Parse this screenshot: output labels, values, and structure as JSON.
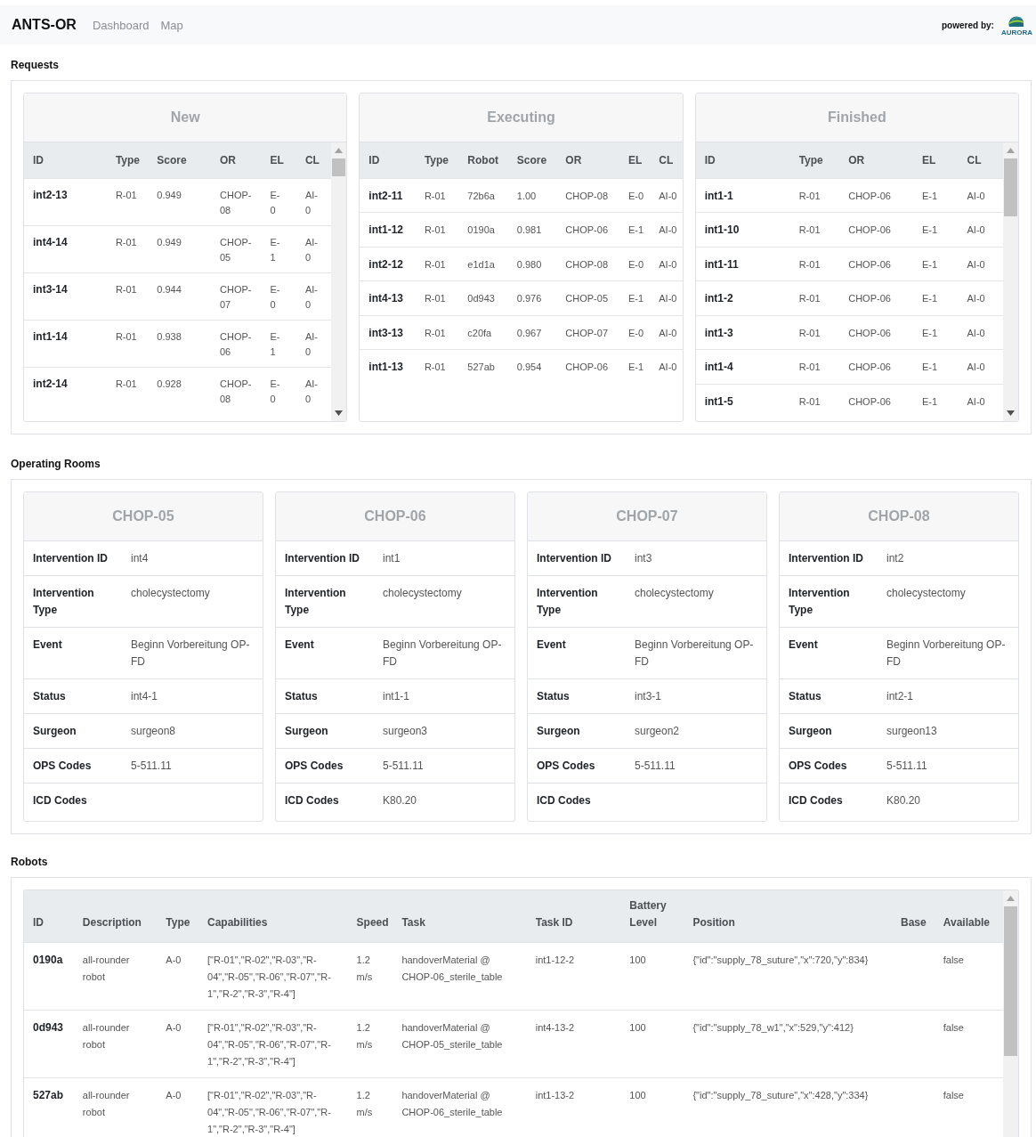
{
  "navbar": {
    "brand": "ANTS-OR",
    "links": [
      {
        "label": "Dashboard"
      },
      {
        "label": "Map"
      }
    ],
    "powered_by": "powered by:",
    "logo_text": "AURORA"
  },
  "requests": {
    "title": "Requests",
    "panels": [
      {
        "title": "New",
        "scrollable": true,
        "columns": [
          "ID",
          "Type",
          "Score",
          "OR",
          "EL",
          "CL"
        ],
        "rows": [
          [
            "int2-13",
            "R-01",
            "0.949",
            "CHOP-08",
            "E-0",
            "AI-0"
          ],
          [
            "int4-14",
            "R-01",
            "0.949",
            "CHOP-05",
            "E-1",
            "AI-0"
          ],
          [
            "int3-14",
            "R-01",
            "0.944",
            "CHOP-07",
            "E-0",
            "AI-0"
          ],
          [
            "int1-14",
            "R-01",
            "0.938",
            "CHOP-06",
            "E-1",
            "AI-0"
          ],
          [
            "int2-14",
            "R-01",
            "0.928",
            "CHOP-08",
            "E-0",
            "AI-0"
          ]
        ]
      },
      {
        "title": "Executing",
        "scrollable": false,
        "columns": [
          "ID",
          "Type",
          "Robot",
          "Score",
          "OR",
          "EL",
          "CL"
        ],
        "rows": [
          [
            "int2-11",
            "R-01",
            "72b6a",
            "1.00",
            "CHOP-08",
            "E-0",
            "AI-0"
          ],
          [
            "int1-12",
            "R-01",
            "0190a",
            "0.981",
            "CHOP-06",
            "E-1",
            "AI-0"
          ],
          [
            "int2-12",
            "R-01",
            "e1d1a",
            "0.980",
            "CHOP-08",
            "E-0",
            "AI-0"
          ],
          [
            "int4-13",
            "R-01",
            "0d943",
            "0.976",
            "CHOP-05",
            "E-1",
            "AI-0"
          ],
          [
            "int3-13",
            "R-01",
            "c20fa",
            "0.967",
            "CHOP-07",
            "E-0",
            "AI-0"
          ],
          [
            "int1-13",
            "R-01",
            "527ab",
            "0.954",
            "CHOP-06",
            "E-1",
            "AI-0"
          ]
        ]
      },
      {
        "title": "Finished",
        "scrollable": true,
        "columns": [
          "ID",
          "Type",
          "OR",
          "EL",
          "CL"
        ],
        "rows": [
          [
            "int1-1",
            "R-01",
            "CHOP-06",
            "E-1",
            "AI-0"
          ],
          [
            "int1-10",
            "R-01",
            "CHOP-06",
            "E-1",
            "AI-0"
          ],
          [
            "int1-11",
            "R-01",
            "CHOP-06",
            "E-1",
            "AI-0"
          ],
          [
            "int1-2",
            "R-01",
            "CHOP-06",
            "E-1",
            "AI-0"
          ],
          [
            "int1-3",
            "R-01",
            "CHOP-06",
            "E-1",
            "AI-0"
          ],
          [
            "int1-4",
            "R-01",
            "CHOP-06",
            "E-1",
            "AI-0"
          ],
          [
            "int1-5",
            "R-01",
            "CHOP-06",
            "E-1",
            "AI-0"
          ]
        ]
      }
    ]
  },
  "operating_rooms": {
    "title": "Operating Rooms",
    "rooms": [
      {
        "name": "CHOP-05",
        "fields": [
          {
            "label": "Intervention ID",
            "value": "int4"
          },
          {
            "label": "Intervention Type",
            "value": "cholecystectomy"
          },
          {
            "label": "Event",
            "value": "Beginn Vorbereitung OP-FD"
          },
          {
            "label": "Status",
            "value": "int4-1"
          },
          {
            "label": "Surgeon",
            "value": "surgeon8"
          },
          {
            "label": "OPS Codes",
            "value": "5-511.11"
          },
          {
            "label": "ICD Codes"
          }
        ]
      },
      {
        "name": "CHOP-06",
        "fields": [
          {
            "label": "Intervention ID",
            "value": "int1"
          },
          {
            "label": "Intervention Type",
            "value": "cholecystectomy"
          },
          {
            "label": "Event",
            "value": "Beginn Vorbereitung OP-FD"
          },
          {
            "label": "Status",
            "value": "int1-1"
          },
          {
            "label": "Surgeon",
            "value": "surgeon3"
          },
          {
            "label": "OPS Codes",
            "value": "5-511.11"
          },
          {
            "label": "ICD Codes",
            "value": "K80.20"
          }
        ]
      },
      {
        "name": "CHOP-07",
        "fields": [
          {
            "label": "Intervention ID",
            "value": "int3"
          },
          {
            "label": "Intervention Type",
            "value": "cholecystectomy"
          },
          {
            "label": "Event",
            "value": "Beginn Vorbereitung OP-FD"
          },
          {
            "label": "Status",
            "value": "int3-1"
          },
          {
            "label": "Surgeon",
            "value": "surgeon2"
          },
          {
            "label": "OPS Codes",
            "value": "5-511.11"
          },
          {
            "label": "ICD Codes"
          }
        ]
      },
      {
        "name": "CHOP-08",
        "fields": [
          {
            "label": "Intervention ID",
            "value": "int2"
          },
          {
            "label": "Intervention Type",
            "value": "cholecystectomy"
          },
          {
            "label": "Event",
            "value": "Beginn Vorbereitung OP-FD"
          },
          {
            "label": "Status",
            "value": "int2-1"
          },
          {
            "label": "Surgeon",
            "value": "surgeon13"
          },
          {
            "label": "OPS Codes",
            "value": "5-511.11"
          },
          {
            "label": "ICD Codes",
            "value": "K80.20"
          }
        ]
      }
    ]
  },
  "robots": {
    "title": "Robots",
    "columns": [
      "ID",
      "Description",
      "Type",
      "Capabilities",
      "Speed",
      "Task",
      "Task ID",
      "Battery Level",
      "Position",
      "Base",
      "Available"
    ],
    "rows": [
      [
        "0190a",
        "all-rounder robot",
        "A-0",
        "[\"R-01\",\"R-02\",\"R-03\",\"R-04\",\"R-05\",\"R-06\",\"R-07\",\"R-1\",\"R-2\",\"R-3\",\"R-4\"]",
        "1.2 m/s",
        "handoverMaterial @ CHOP-06_sterile_table",
        "int1-12-2",
        "100",
        "{\"id\":\"supply_78_suture\",\"x\":720,\"y\":834}",
        "",
        "false"
      ],
      [
        "0d943",
        "all-rounder robot",
        "A-0",
        "[\"R-01\",\"R-02\",\"R-03\",\"R-04\",\"R-05\",\"R-06\",\"R-07\",\"R-1\",\"R-2\",\"R-3\",\"R-4\"]",
        "1.2 m/s",
        "handoverMaterial @ CHOP-05_sterile_table",
        "int4-13-2",
        "100",
        "{\"id\":\"supply_78_w1\",\"x\":529,\"y\":412}",
        "",
        "false"
      ],
      [
        "527ab",
        "all-rounder robot",
        "A-0",
        "[\"R-01\",\"R-02\",\"R-03\",\"R-04\",\"R-05\",\"R-06\",\"R-07\",\"R-1\",\"R-2\",\"R-3\",\"R-4\"]",
        "1.2 m/s",
        "handoverMaterial @ CHOP-06_sterile_table",
        "int1-13-2",
        "100",
        "{\"id\":\"supply_78_suture\",\"x\":428,\"y\":334}",
        "",
        "false"
      ]
    ]
  }
}
